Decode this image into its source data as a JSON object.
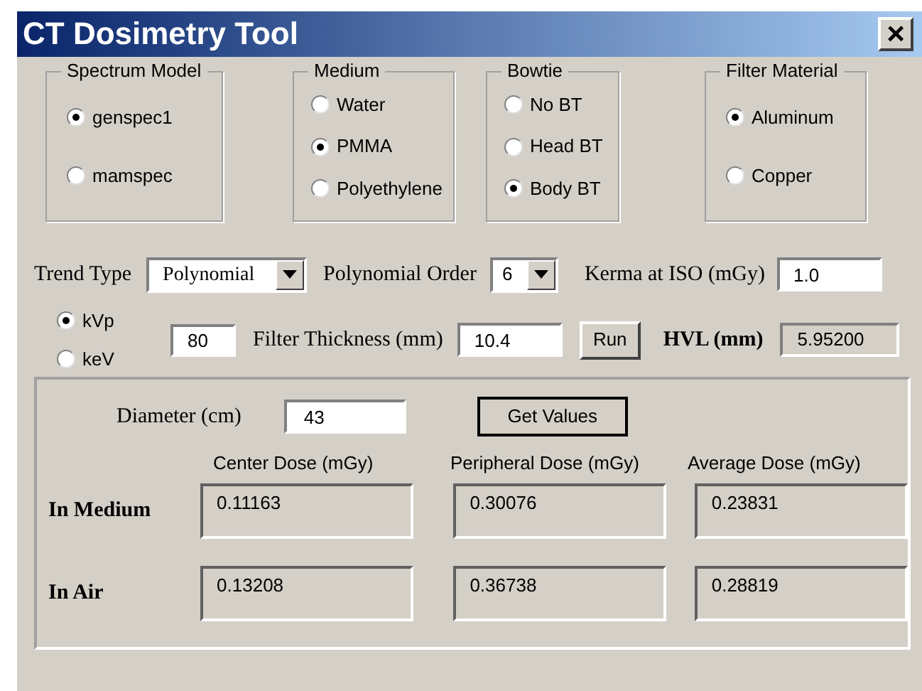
{
  "window": {
    "title": "CT Dosimetry Tool",
    "close": "×"
  },
  "groups": [
    {
      "label": "Spectrum Model",
      "options": [
        {
          "label": "genspec1",
          "selected": true
        },
        {
          "label": "mamspec",
          "selected": false
        }
      ]
    },
    {
      "label": "Medium",
      "options": [
        {
          "label": "Water",
          "selected": false
        },
        {
          "label": "PMMA",
          "selected": true
        },
        {
          "label": "Polyethylene",
          "selected": false
        }
      ]
    },
    {
      "label": "Bowtie",
      "options": [
        {
          "label": "No BT",
          "selected": false
        },
        {
          "label": "Head BT",
          "selected": false
        },
        {
          "label": "Body BT",
          "selected": true
        }
      ]
    },
    {
      "label": "Filter Material",
      "options": [
        {
          "label": "Aluminum",
          "selected": true
        },
        {
          "label": "Copper",
          "selected": false
        }
      ]
    }
  ],
  "trend_type": {
    "label": "Trend Type",
    "value": "Polynomial"
  },
  "polynomial_order": {
    "label": "Polynomial Order",
    "value": "6"
  },
  "kerma": {
    "label": "Kerma at ISO (mGy)",
    "value": "1.0"
  },
  "energy_unit": [
    {
      "label": "kVp",
      "selected": true
    },
    {
      "label": "keV",
      "selected": false
    }
  ],
  "energy_value": "80",
  "filter_thickness": {
    "label": "Filter Thickness (mm)",
    "value": "10.4"
  },
  "run_button": "Run",
  "hvl": {
    "label": "HVL (mm)",
    "value": "5.95200"
  },
  "diameter": {
    "label": "Diameter (cm)",
    "value": "43"
  },
  "get_values_button": "Get Values",
  "results": {
    "columns": [
      "Center Dose (mGy)",
      "Peripheral Dose (mGy)",
      "Average Dose (mGy)"
    ],
    "rows": [
      {
        "label": "In Medium",
        "values": [
          "0.11163",
          "0.30076",
          "0.23831"
        ]
      },
      {
        "label": "In Air",
        "values": [
          "0.13208",
          "0.36738",
          "0.28819"
        ]
      }
    ]
  }
}
